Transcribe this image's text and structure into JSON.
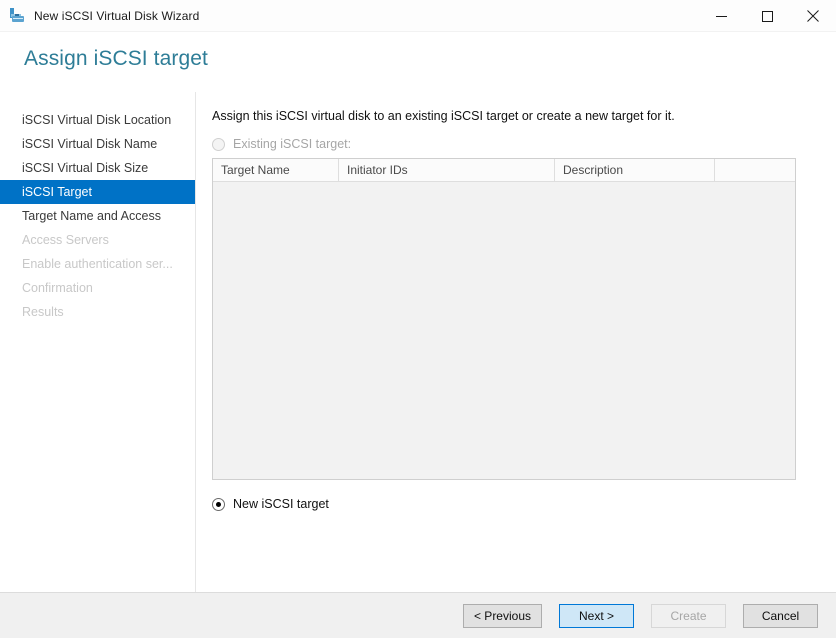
{
  "window": {
    "title": "New iSCSI Virtual Disk Wizard",
    "icon": "iscsi-virtual-disk-icon",
    "controls": {
      "minimize": "minimize-icon",
      "maximize": "maximize-icon",
      "close": "close-icon"
    }
  },
  "header": {
    "title": "Assign iSCSI target",
    "title_color": "#2e7d97"
  },
  "sidebar": {
    "items": [
      {
        "label": "iSCSI Virtual Disk Location",
        "state": "done"
      },
      {
        "label": "iSCSI Virtual Disk Name",
        "state": "done"
      },
      {
        "label": "iSCSI Virtual Disk Size",
        "state": "done"
      },
      {
        "label": "iSCSI Target",
        "state": "selected"
      },
      {
        "label": "Target Name and Access",
        "state": "done"
      },
      {
        "label": "Access Servers",
        "state": "disabled"
      },
      {
        "label": "Enable authentication ser...",
        "state": "disabled"
      },
      {
        "label": "Confirmation",
        "state": "disabled"
      },
      {
        "label": "Results",
        "state": "disabled"
      }
    ],
    "selected_bg": "#0072c6",
    "selected_fg": "#ffffff"
  },
  "main": {
    "intro": "Assign this iSCSI virtual disk to an existing iSCSI target or create a new target for it.",
    "existing_target": {
      "label": "Existing iSCSI target:",
      "selected": false,
      "enabled": false
    },
    "new_target": {
      "label": "New iSCSI target",
      "selected": true,
      "enabled": true
    },
    "target_list": {
      "columns": [
        "Target Name",
        "Initiator IDs",
        "Description",
        ""
      ],
      "rows": []
    }
  },
  "footer": {
    "buttons": [
      {
        "label": "< Previous",
        "state": "normal",
        "name": "previous-button"
      },
      {
        "label": "Next >",
        "state": "focused",
        "name": "next-button"
      },
      {
        "label": "Create",
        "state": "disabled",
        "name": "create-button"
      },
      {
        "label": "Cancel",
        "state": "normal",
        "name": "cancel-button"
      }
    ]
  }
}
